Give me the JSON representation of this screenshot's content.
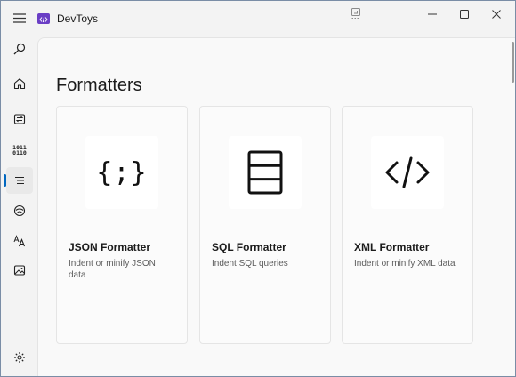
{
  "app": {
    "title": "DevToys"
  },
  "sidebar": {
    "items": [
      {
        "icon": "search-icon",
        "selected": false
      },
      {
        "icon": "home-icon",
        "selected": false
      },
      {
        "icon": "converters-icon",
        "selected": false
      },
      {
        "icon": "encoders-decoders-icon",
        "selected": false,
        "glyph_lines": [
          "1011",
          "0110"
        ]
      },
      {
        "icon": "formatters-icon",
        "selected": true
      },
      {
        "icon": "generators-icon",
        "selected": false
      },
      {
        "icon": "text-icon",
        "selected": false
      },
      {
        "icon": "graphic-icon",
        "selected": false
      }
    ],
    "footer": {
      "icon": "settings-icon"
    }
  },
  "main": {
    "title": "Formatters",
    "cards": [
      {
        "icon": "json-braces-icon",
        "glyph": "{;}",
        "title": "JSON Formatter",
        "description": "Indent or minify JSON data"
      },
      {
        "icon": "database-icon",
        "title": "SQL Formatter",
        "description": "Indent SQL queries"
      },
      {
        "icon": "code-tag-icon",
        "title": "XML Formatter",
        "description": "Indent or minify XML data"
      }
    ]
  },
  "colors": {
    "accent": "#0067c0",
    "brand": "#6a3ec5",
    "window_bg": "#f3f3f3",
    "content_bg": "#f9f9f9"
  }
}
